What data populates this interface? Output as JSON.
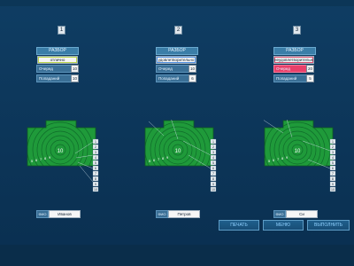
{
  "lanes": [
    {
      "number": "1",
      "section_label": "РАЗБОР",
      "rating": "отлично",
      "rating_class": "good",
      "shots_label": "Очеред",
      "shots": "10",
      "hits_label": "Попаданий",
      "hits": "10",
      "center_label": "10",
      "ring_labels": [
        "5",
        "6",
        "7",
        "8",
        "9"
      ],
      "scale": [
        "1",
        "2",
        "3",
        "4",
        "5",
        "6",
        "7",
        "8",
        "9",
        "10"
      ],
      "fio_label": "ФИО",
      "fio": "Иванов"
    },
    {
      "number": "2",
      "section_label": "РАЗБОР",
      "rating": "удовлетворительно",
      "rating_class": "ok",
      "shots_label": "Очеред",
      "shots": "10",
      "hits_label": "Попаданий",
      "hits": "6",
      "center_label": "10",
      "ring_labels": [
        "5",
        "6",
        "7",
        "8",
        "9"
      ],
      "scale": [
        "1",
        "2",
        "3",
        "4",
        "5",
        "6",
        "7",
        "8",
        "9",
        "10"
      ],
      "fio_label": "ФИО",
      "fio": "Петров"
    },
    {
      "number": "3",
      "section_label": "РАЗБОР",
      "rating": "неудовлетворительно",
      "rating_class": "bad",
      "shots_label": "Очеред",
      "shots": "20",
      "hits_label": "Попаданий",
      "hits": "5",
      "center_label": "10",
      "ring_labels": [
        "5",
        "6",
        "7",
        "8",
        "9"
      ],
      "scale": [
        "1",
        "2",
        "3",
        "4",
        "5",
        "6",
        "7",
        "8",
        "9",
        "10"
      ],
      "fio_label": "ФИО",
      "fio": "Си"
    }
  ],
  "buttons": {
    "print": "ПЕЧАТЬ",
    "menu": "МЕНЮ",
    "execute": "ВЫПОЛНИТЬ"
  }
}
